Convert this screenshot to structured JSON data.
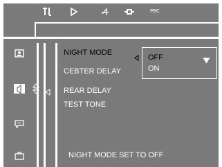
{
  "top_bar": {
    "icons": [
      "audio-settings-icon",
      "play-icon",
      "speaker-setup-icon",
      "dolby-icon"
    ],
    "pbc_label": "PBC"
  },
  "sidebar": {
    "items": [
      {
        "icon": "general-setup-icon",
        "selected": false
      },
      {
        "icon": "speaker-icon",
        "selected": true
      },
      {
        "icon": "subtitle-icon",
        "selected": false
      },
      {
        "icon": "preferences-icon",
        "selected": false
      }
    ]
  },
  "menu": {
    "items": [
      {
        "label": "NIGHT MODE",
        "active": true
      },
      {
        "label": "CEBTER DELAY",
        "active": false
      },
      {
        "label": "REAR DELAY",
        "active": false
      },
      {
        "label": "TEST TONE",
        "active": false
      }
    ]
  },
  "dropdown": {
    "options": [
      "OFF",
      "ON"
    ],
    "selected": "OFF"
  },
  "status_text": "NIGHT MODE SET TO OFF",
  "colors": {
    "panel": "#7a7a7a",
    "text": "#ffffff",
    "active_text": "#000000"
  }
}
